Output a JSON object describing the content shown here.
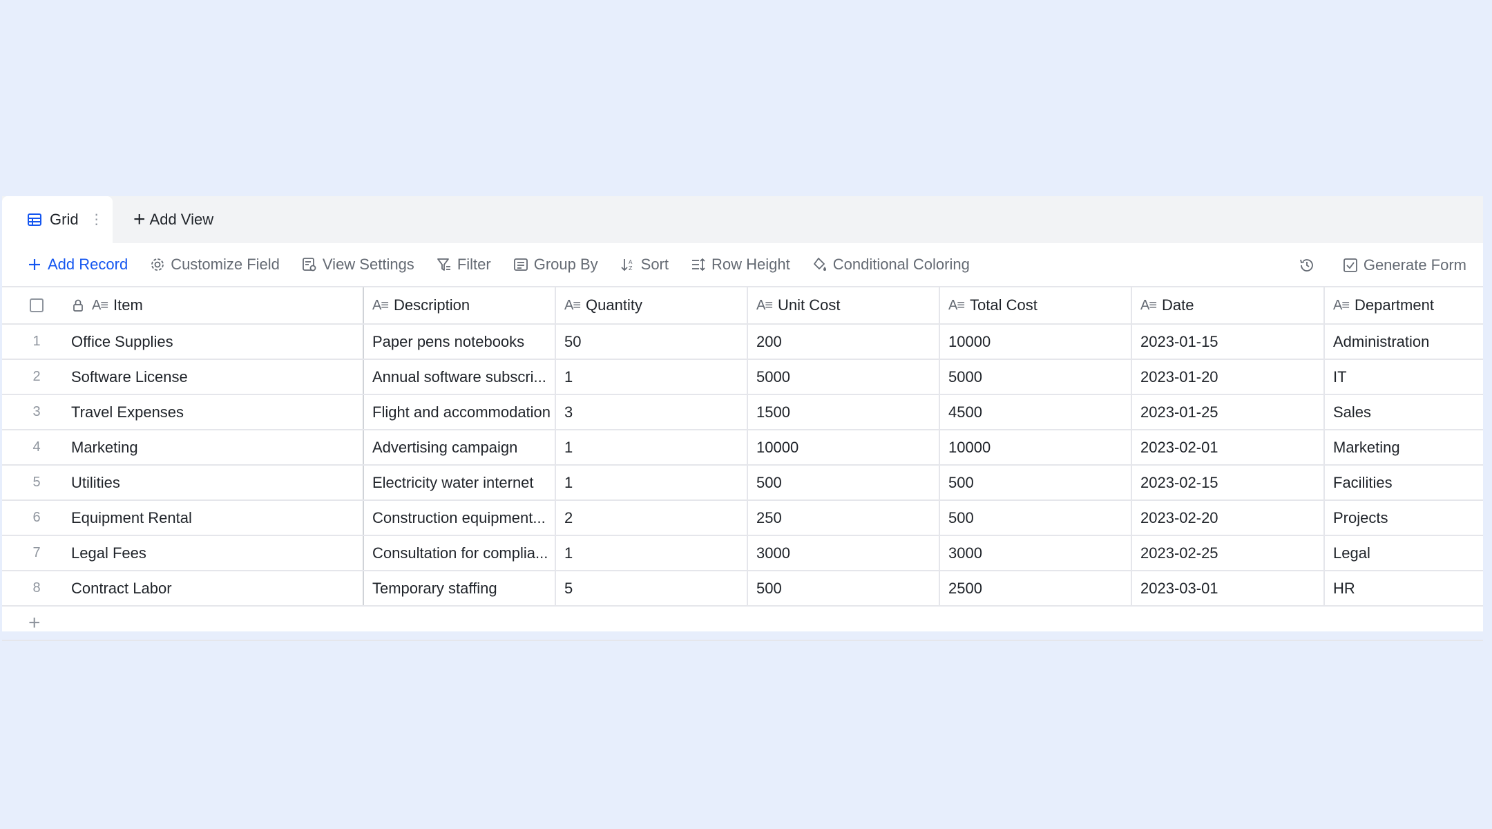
{
  "tabs": {
    "grid_label": "Grid",
    "add_view_label": "Add View"
  },
  "toolbar": {
    "add_record": "Add Record",
    "customize_field": "Customize Field",
    "view_settings": "View Settings",
    "filter": "Filter",
    "group_by": "Group By",
    "sort": "Sort",
    "row_height": "Row Height",
    "conditional_coloring": "Conditional Coloring",
    "generate_form": "Generate Form"
  },
  "columns": {
    "item": "Item",
    "description": "Description",
    "quantity": "Quantity",
    "unit_cost": "Unit Cost",
    "total_cost": "Total Cost",
    "date": "Date",
    "department": "Department"
  },
  "rows": [
    {
      "num": "1",
      "item": "Office Supplies",
      "description": "Paper pens notebooks",
      "quantity": "50",
      "unit_cost": "200",
      "total_cost": "10000",
      "date": "2023-01-15",
      "department": "Administration"
    },
    {
      "num": "2",
      "item": "Software License",
      "description": "Annual software subscri...",
      "quantity": "1",
      "unit_cost": "5000",
      "total_cost": "5000",
      "date": "2023-01-20",
      "department": "IT"
    },
    {
      "num": "3",
      "item": "Travel Expenses",
      "description": "Flight and accommodation",
      "quantity": "3",
      "unit_cost": "1500",
      "total_cost": "4500",
      "date": "2023-01-25",
      "department": "Sales"
    },
    {
      "num": "4",
      "item": "Marketing",
      "description": "Advertising campaign",
      "quantity": "1",
      "unit_cost": "10000",
      "total_cost": "10000",
      "date": "2023-02-01",
      "department": "Marketing"
    },
    {
      "num": "5",
      "item": "Utilities",
      "description": "Electricity water internet",
      "quantity": "1",
      "unit_cost": "500",
      "total_cost": "500",
      "date": "2023-02-15",
      "department": "Facilities"
    },
    {
      "num": "6",
      "item": "Equipment Rental",
      "description": "Construction equipment...",
      "quantity": "2",
      "unit_cost": "250",
      "total_cost": "500",
      "date": "2023-02-20",
      "department": "Projects"
    },
    {
      "num": "7",
      "item": "Legal Fees",
      "description": "Consultation for complia...",
      "quantity": "1",
      "unit_cost": "3000",
      "total_cost": "3000",
      "date": "2023-02-25",
      "department": "Legal"
    },
    {
      "num": "8",
      "item": "Contract Labor",
      "description": "Temporary staffing",
      "quantity": "5",
      "unit_cost": "500",
      "total_cost": "2500",
      "date": "2023-03-01",
      "department": "HR"
    }
  ],
  "colors": {
    "background": "#e7eefc",
    "accent": "#1456f0",
    "muted_text": "#646a73",
    "border": "#e5e6eb"
  }
}
